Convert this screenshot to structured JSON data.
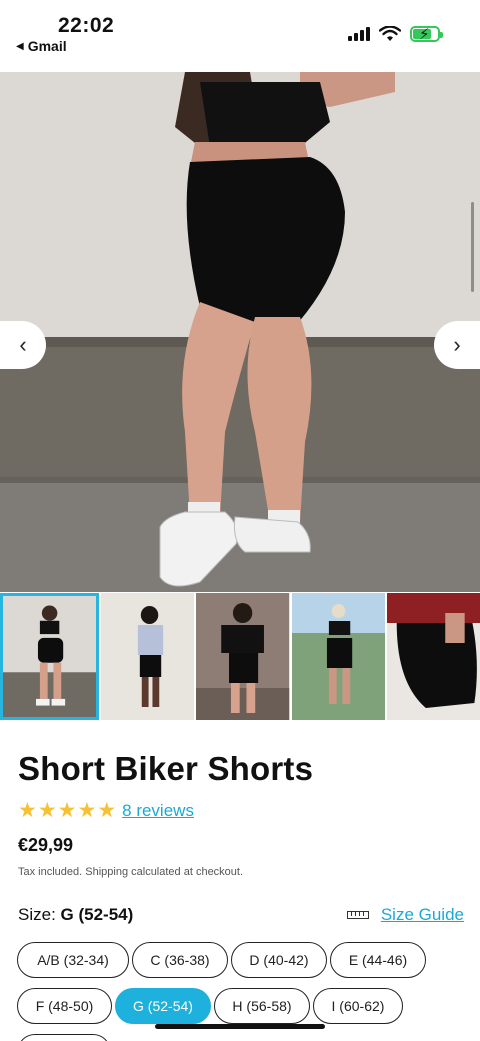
{
  "status_bar": {
    "time": "22:02",
    "back_app": "Gmail",
    "icons": [
      "cellular-signal",
      "wifi",
      "battery-charging"
    ],
    "battery_color": "#34c759"
  },
  "gallery": {
    "prev_icon": "chevron-left",
    "next_icon": "chevron-right",
    "thumbnail_count": 5,
    "active_thumbnail": 0
  },
  "product": {
    "title": "Short Biker Shorts",
    "star_count": 5,
    "star_color": "#f6c234",
    "reviews_label": "8 reviews",
    "price": "€29,99",
    "tax_note": "Tax included. Shipping calculated at checkout."
  },
  "size": {
    "label": "Size:",
    "selected": "G (52-54)",
    "guide_label": "Size Guide",
    "options": [
      "A/B (32-34)",
      "C (36-38)",
      "D (40-42)",
      "E (44-46)",
      "F (48-50)",
      "G (52-54)",
      "H (56-58)",
      "I (60-62)"
    ],
    "accent_color": "#1fb1dd"
  }
}
